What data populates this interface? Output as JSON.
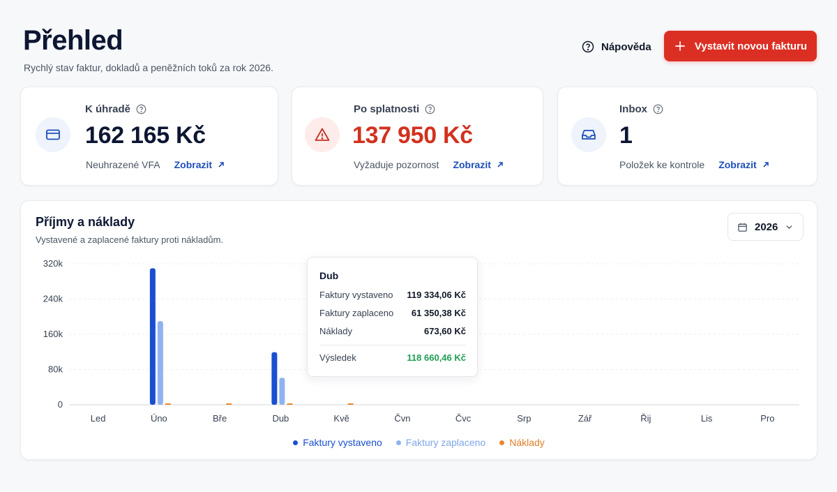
{
  "header": {
    "title": "Přehled",
    "subtitle": "Rychlý stav faktur, dokladů a peněžních toků za rok 2026.",
    "help_label": "Nápověda",
    "primary_action": "Vystavit novou fakturu"
  },
  "colors": {
    "brand_red": "#dc2f23",
    "alert_red": "#d1321f",
    "link_blue": "#1d4fb8",
    "series_issued": "#1a4fd1",
    "series_paid": "#8fb3f0",
    "series_costs": "#e9872e",
    "positive_green": "#1f9d55"
  },
  "kpis": [
    {
      "icon": "credit-card-icon",
      "label": "K úhradě",
      "value": "162 165 Kč",
      "note": "Neuhrazené VFA",
      "link": "Zobrazit"
    },
    {
      "icon": "warning-triangle-icon",
      "label": "Po splatnosti",
      "value": "137 950 Kč",
      "note": "Vyžaduje pozornost",
      "link": "Zobrazit"
    },
    {
      "icon": "inbox-tray-icon",
      "label": "Inbox",
      "value": "1",
      "note": "Položek ke kontrole",
      "link": "Zobrazit"
    }
  ],
  "chart_panel": {
    "title": "Příjmy a náklady",
    "subtitle": "Vystavené a zaplacené faktury proti nákladům.",
    "year_select": "2026"
  },
  "tooltip": {
    "title": "Dub",
    "rows": [
      {
        "label": "Faktury vystaveno",
        "value": "119 334,06 Kč"
      },
      {
        "label": "Faktury zaplaceno",
        "value": "61 350,38 Kč"
      },
      {
        "label": "Náklady",
        "value": "673,60 Kč"
      }
    ],
    "result_label": "Výsledek",
    "result_value": "118 660,46 Kč"
  },
  "chart_data": {
    "type": "bar",
    "categories": [
      "Led",
      "Úno",
      "Bře",
      "Dub",
      "Kvě",
      "Čvn",
      "Čvc",
      "Srp",
      "Zář",
      "Řij",
      "Lis",
      "Pro"
    ],
    "series": [
      {
        "name": "Faktury vystaveno",
        "values": [
          0,
          310000,
          0,
          119334.06,
          0,
          0,
          0,
          0,
          0,
          0,
          0,
          0
        ]
      },
      {
        "name": "Faktury zaplaceno",
        "values": [
          0,
          190000,
          0,
          61350.38,
          0,
          0,
          0,
          0,
          0,
          0,
          0,
          0
        ]
      },
      {
        "name": "Náklady",
        "values": [
          0,
          1000,
          1200,
          673.6,
          800,
          0,
          0,
          0,
          0,
          0,
          0,
          0
        ]
      }
    ],
    "yticks": [
      "0",
      "80k",
      "160k",
      "240k",
      "320k"
    ],
    "ylim": [
      0,
      320000
    ],
    "grid": true,
    "legend_position": "bottom"
  }
}
